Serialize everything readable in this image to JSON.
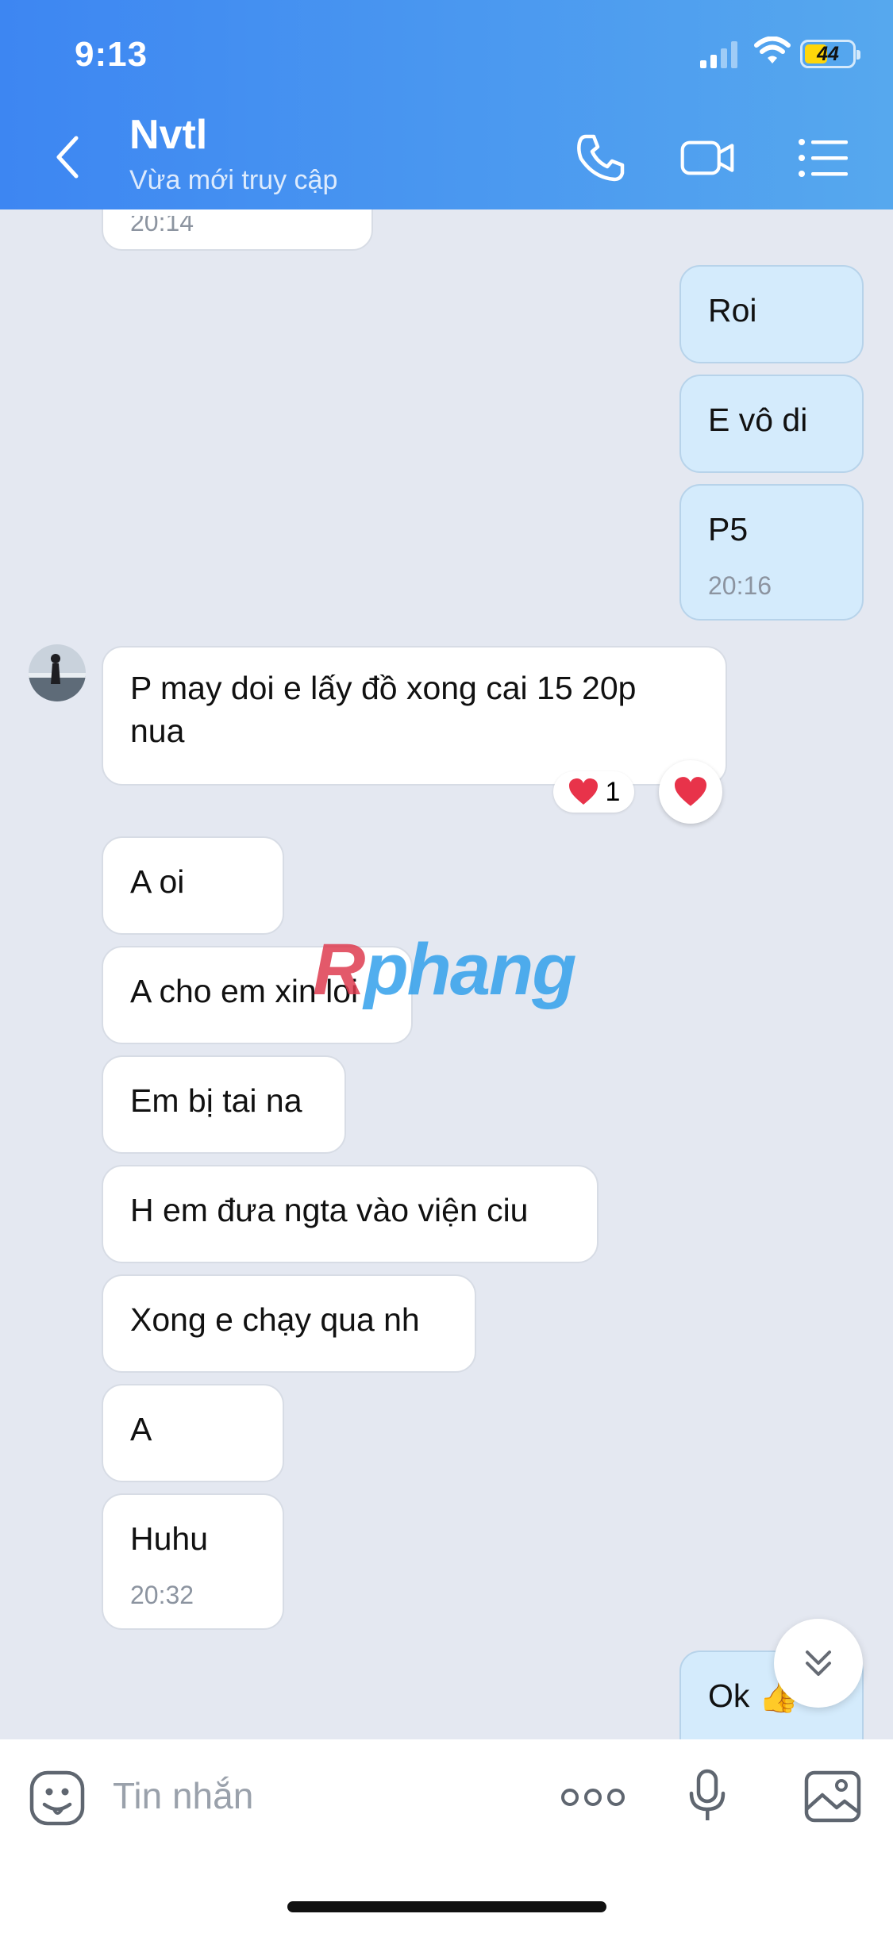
{
  "status_bar": {
    "time": "9:13",
    "battery": "44"
  },
  "header": {
    "name": "Nvtl",
    "status": "Vừa mới truy cập"
  },
  "messages": {
    "top_partial_time": "20:14",
    "out": [
      "Roi",
      "E vô di",
      "P5"
    ],
    "out_time": "20:16",
    "reacted_text": "P may doi e lấy đồ xong cai 15 20p nua",
    "reaction_count": "1",
    "in": [
      "A oi",
      "A cho em xin loi",
      "Em bị tai na",
      "H em đưa ngta vào viện ciu",
      "Xong e chạy qua nh",
      "A",
      "Huhu"
    ],
    "in_time": "20:32",
    "last_out": "Ok 👍"
  },
  "watermark": {
    "part1": "R",
    "part2": "phang"
  },
  "composer": {
    "placeholder": "Tin nhắn"
  },
  "colors": {
    "header_start": "#3d86f2",
    "header_end": "#56a8ee",
    "chat_bg": "#e4e8f1",
    "outgoing_bubble": "#d4ebfc",
    "incoming_bubble": "#ffffff",
    "heart": "#e8334a"
  }
}
